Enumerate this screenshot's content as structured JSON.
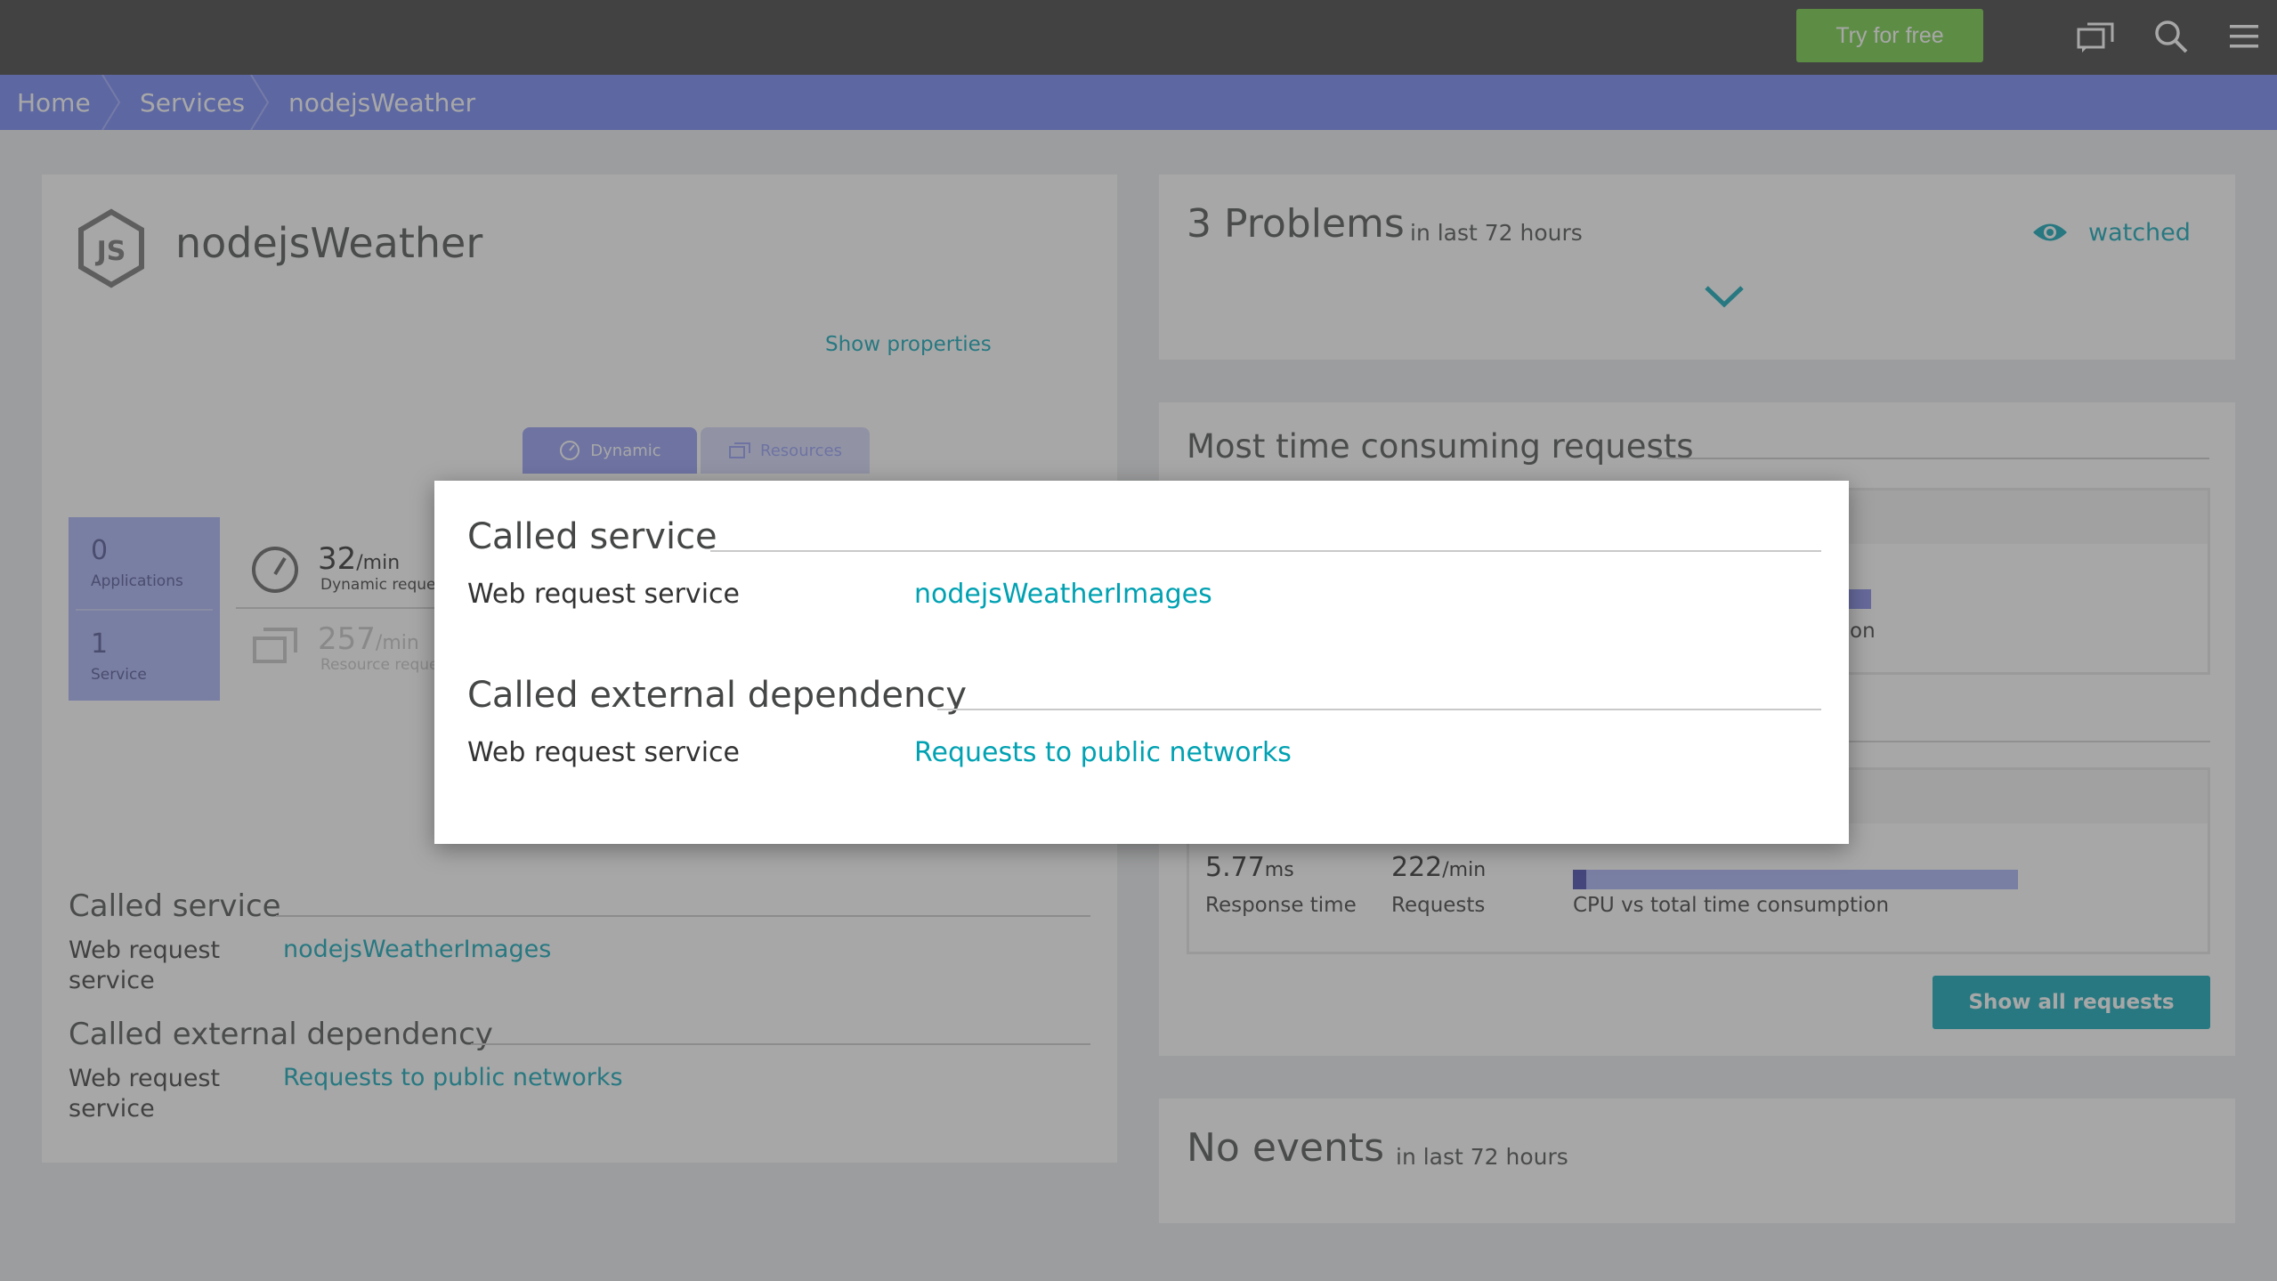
{
  "topbar": {
    "try_label": "Try for free",
    "icons": [
      "chat-windows-icon",
      "search-icon",
      "menu-icon"
    ]
  },
  "breadcrumb": [
    "Home",
    "Services",
    "nodejsWeather"
  ],
  "service": {
    "name": "nodejsWeather",
    "show_properties": "Show properties",
    "tabs": [
      "Dynamic",
      "Resources"
    ],
    "counts": [
      {
        "value": "0",
        "label": "Applications"
      },
      {
        "value": "1",
        "label": "Service"
      }
    ],
    "metrics": [
      {
        "value": "32",
        "unit": "/min",
        "label": "Dynamic reques"
      },
      {
        "value": "257",
        "unit": "/min",
        "label": "Resource reque"
      }
    ],
    "called_service": {
      "title": "Called service",
      "type": "Web request service",
      "link": "nodejsWeatherImages"
    },
    "called_external": {
      "title": "Called external dependency",
      "type": "Web request service",
      "link": "Requests to public networks"
    }
  },
  "problems": {
    "count_label": "3 Problems",
    "period": "in last 72 hours",
    "watched": "watched"
  },
  "requests": {
    "title": "Most time consuming requests",
    "partial_label": "on",
    "row": {
      "response_value": "5.77",
      "response_unit": "ms",
      "response_label": "Response time",
      "requests_value": "222",
      "requests_unit": "/min",
      "requests_label": "Requests",
      "cpu_label": "CPU vs total time consumption",
      "cpu_fraction": 0.03
    },
    "show_all": "Show all requests"
  },
  "events": {
    "title": "No events",
    "period": "in last 72 hours"
  },
  "modal": {
    "called_service_title": "Called service",
    "called_service_type": "Web request service",
    "called_service_link": "nodejsWeatherImages",
    "external_title": "Called external dependency",
    "external_type": "Web request service",
    "external_link": "Requests to public networks"
  },
  "colors": {
    "accent": "#00a1b2",
    "breadcrumb": "#6b7ff5",
    "topbar": "#353535",
    "try_button": "#6bcb3b",
    "bar": "#7d83e6"
  }
}
